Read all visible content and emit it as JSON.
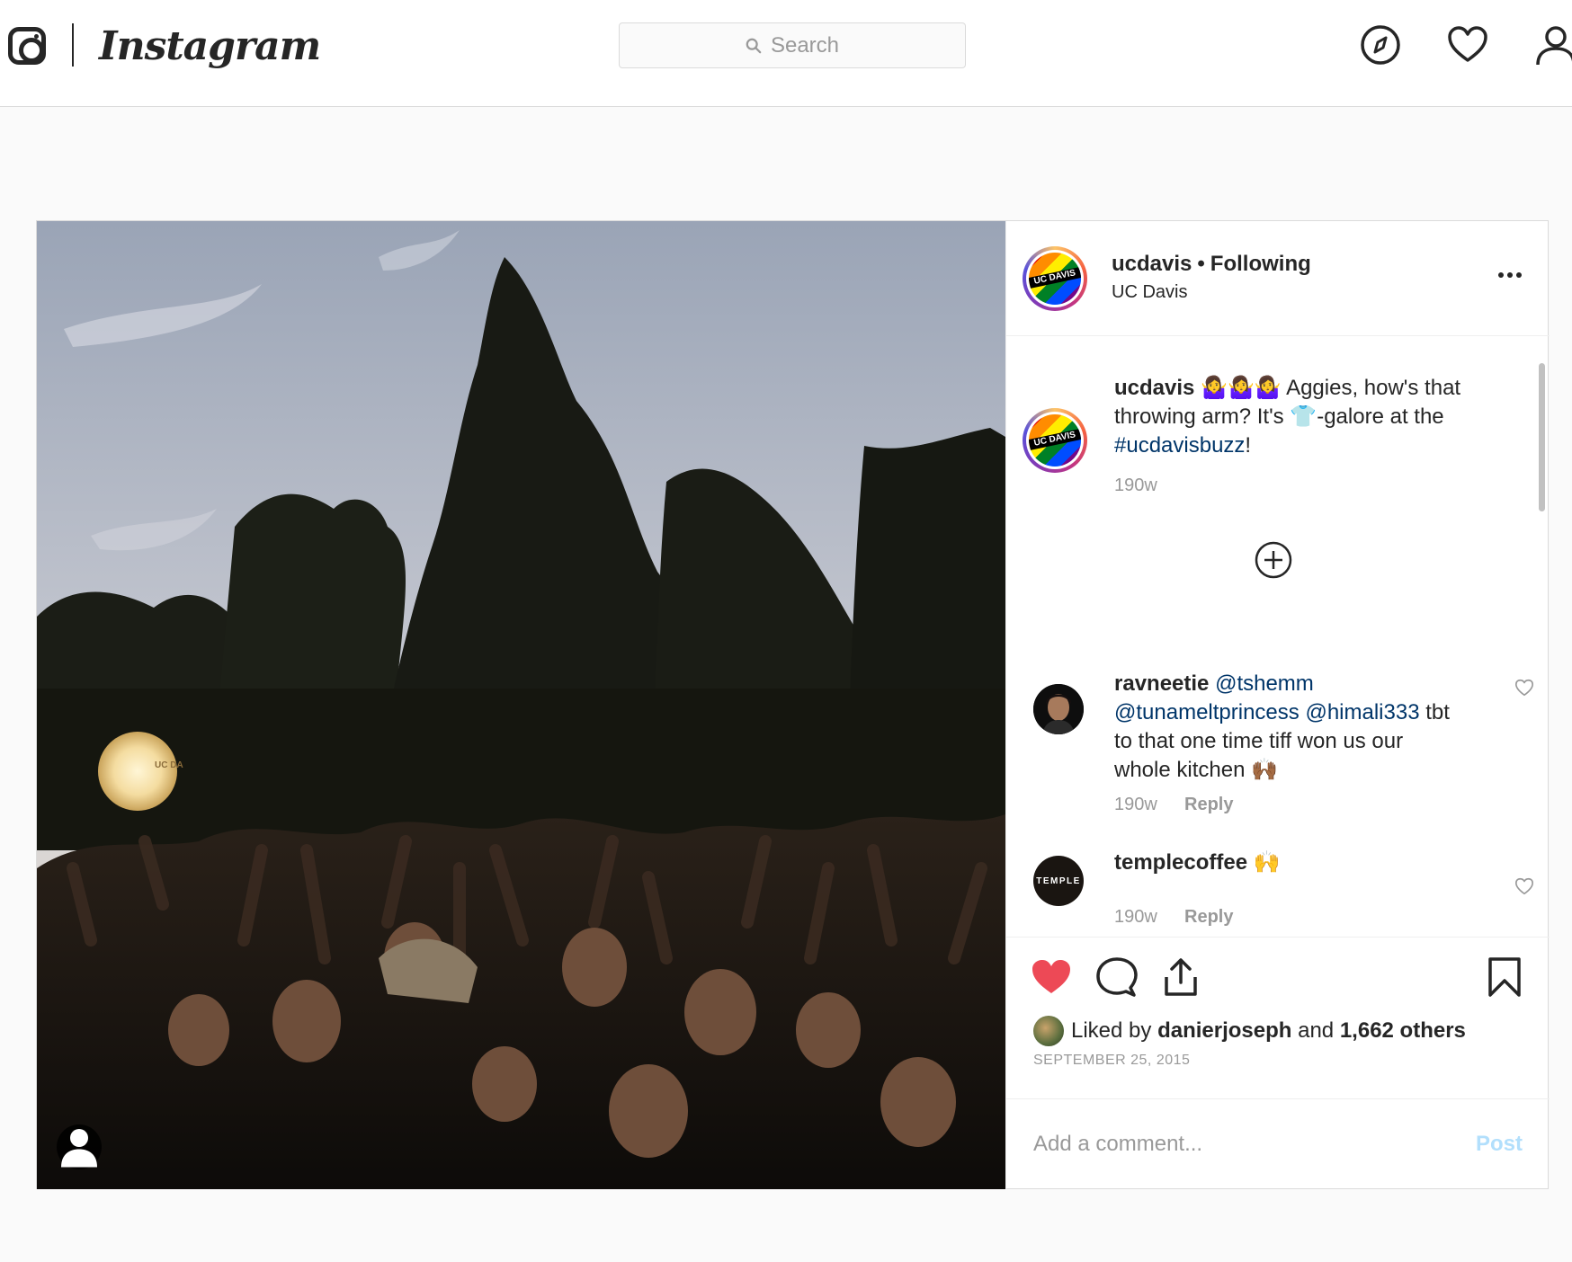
{
  "nav": {
    "brand": "Instagram",
    "search_placeholder": "Search",
    "icons": [
      "instagram-glyph-icon",
      "explore-compass-icon",
      "activity-heart-icon",
      "profile-icon"
    ]
  },
  "post": {
    "author": "ucdavis",
    "follow_status": "Following",
    "location": "UC Davis",
    "avatar_text": "UC DAVIS",
    "caption": {
      "username": "ucdavis",
      "emoji_prefix": "🤷‍♀️🤷‍♀️🤷‍♀️",
      "text_1": "Aggies, how's that throwing arm? It's",
      "emoji_mid": "👕",
      "text_2": "-galore at the",
      "hashtag": "#ucdavisbuzz",
      "text_3": "!",
      "time": "190w"
    },
    "comments": [
      {
        "username": "ravneetie",
        "mentions": [
          "@tshemm",
          "@tunameltprincess",
          "@himali333"
        ],
        "text": "tbt to that one time tiff won us our whole kitchen",
        "emoji": "🙌🏾",
        "time": "190w",
        "reply_label": "Reply"
      },
      {
        "username": "templecoffee",
        "emoji": "🙌",
        "avatar_text": "TEMPLE",
        "time": "190w",
        "reply_label": "Reply"
      }
    ],
    "liked_by_prefix": "Liked by",
    "liked_by_user": "danierjoseph",
    "liked_by_and": "and",
    "liked_by_others": "1,662 others",
    "date": "SEPTEMBER 25, 2015",
    "liked": true,
    "add_comment_placeholder": "Add a comment...",
    "post_button": "Post",
    "balloon_text": "UC DA"
  },
  "colors": {
    "like_red": "#ed4956",
    "link_blue": "#003569",
    "post_button_disabled": "#b2dffc"
  }
}
